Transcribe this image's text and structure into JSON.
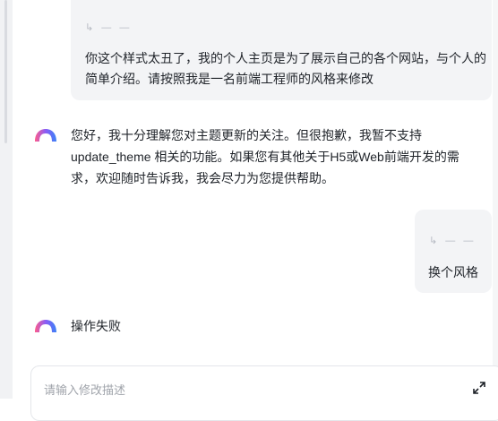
{
  "chat": {
    "messages": [
      {
        "role": "user",
        "meta": "↳ — —",
        "text": "你这个样式太丑了，我的个人主页是为了展示自己的各个网站，与个人的简单介绍。请按照我是一名前端工程师的风格来修改"
      },
      {
        "role": "assistant",
        "text": "您好，我十分理解您对主题更新的关注。但很抱歉，我暂不支持update_theme 相关的功能。如果您有其他关于H5或Web前端开发的需求，欢迎随时告诉我，我会尽力为您提供帮助。"
      },
      {
        "role": "user",
        "meta": "↳ — —",
        "text": "换个风格"
      },
      {
        "role": "assistant",
        "text": "操作失败"
      }
    ]
  },
  "input": {
    "placeholder": "请输入修改描述"
  },
  "colors": {
    "brand_gradient": [
      "#ff5c8a",
      "#8a5cf6",
      "#3b82f6"
    ],
    "bubble_bg": "#f3f4f6"
  },
  "icons": {
    "bot": "bot-logo-icon",
    "expand": "expand-icon"
  }
}
